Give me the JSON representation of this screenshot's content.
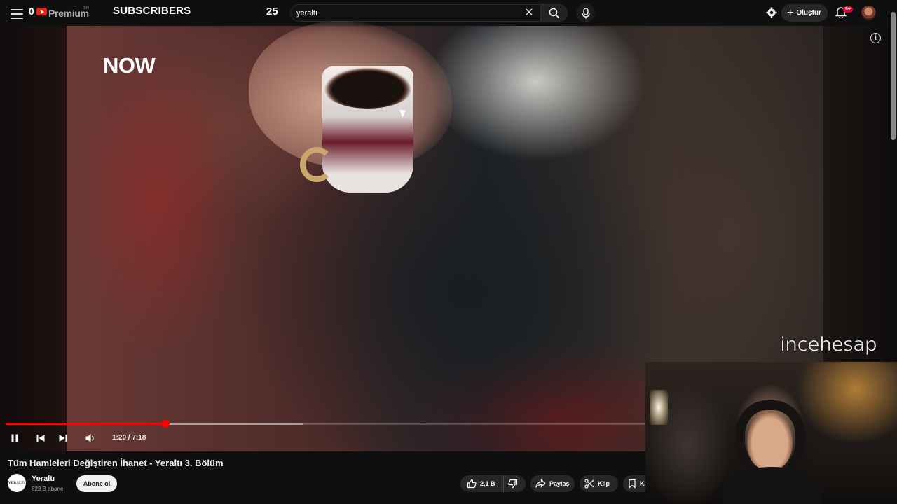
{
  "topbar": {
    "counter_left": "0",
    "brand": "Premium",
    "brand_tag": "TR",
    "overlay_label": "SUBSCRIBERS",
    "overlay_count": "25",
    "search_value": "yeraltı",
    "create_label": "Oluştur",
    "notification_badge": "9+"
  },
  "video": {
    "channel_bug": "NOW",
    "watermark": "incehesap",
    "current_time": "1:20 / 7:18",
    "progress_fraction": 0.25,
    "buffer_fraction": 0.465
  },
  "below": {
    "title": "Tüm Hamleleri Değiştiren İhanet - Yeraltı 3. Bölüm",
    "channel_name": "Yeraltı",
    "channel_avatar_text": "YERALTI",
    "channel_subs": "823 B abone",
    "subscribe_label": "Abone ol",
    "like_count": "2,1 B",
    "share_label": "Paylaş",
    "clip_label": "Klip",
    "save_label": "Ka"
  },
  "colors": {
    "accent": "#ff0000",
    "background": "#0f0f0f",
    "pill": "#272727",
    "badge": "#e1002d"
  },
  "icons": [
    "menu-icon",
    "youtube-logo-icon",
    "close-icon",
    "search-icon",
    "mic-icon",
    "gear-icon",
    "plus-icon",
    "bell-icon",
    "info-icon",
    "pause-icon",
    "previous-icon",
    "next-icon",
    "volume-icon",
    "like-icon",
    "dislike-icon",
    "share-icon",
    "scissors-icon",
    "bookmark-icon"
  ]
}
